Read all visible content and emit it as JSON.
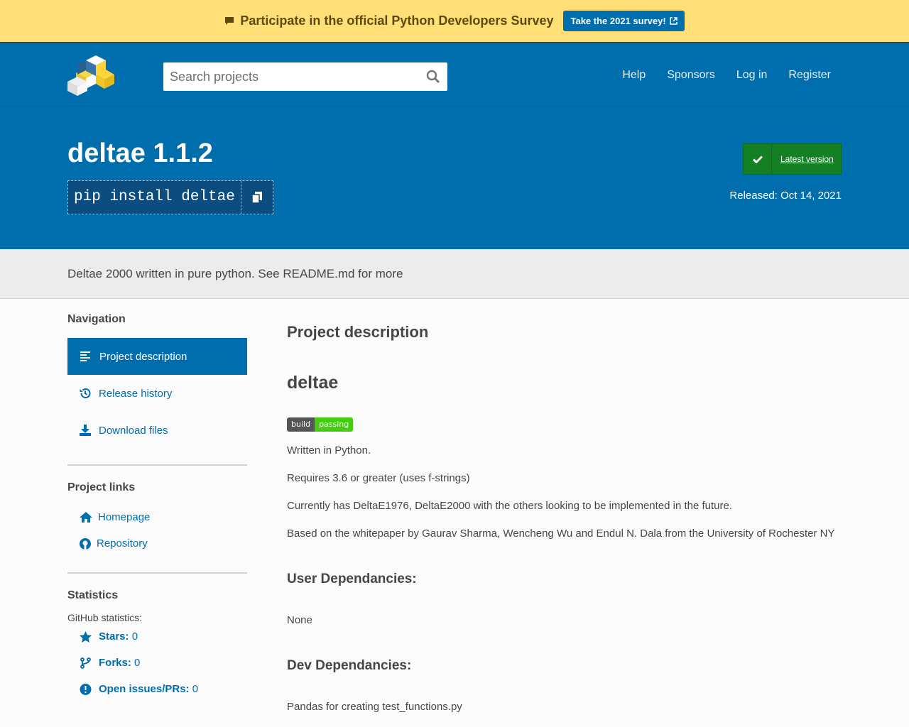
{
  "survey": {
    "message": "Participate in the official Python Developers Survey",
    "button_label": "Take the 2021 survey!"
  },
  "header": {
    "search_placeholder": "Search projects",
    "nav": [
      "Help",
      "Sponsors",
      "Log in",
      "Register"
    ]
  },
  "package": {
    "title": "deltae 1.1.2",
    "pip_command": "pip install deltae",
    "latest_label": "Latest version",
    "released": "Released: Oct 14, 2021",
    "summary": "Deltae 2000 written in pure python. See README.md for more"
  },
  "sidebar": {
    "navigation_heading": "Navigation",
    "nav_items": [
      {
        "label": "Project description",
        "icon": "align-left-icon",
        "active": true
      },
      {
        "label": "Release history",
        "icon": "history-icon",
        "active": false
      },
      {
        "label": "Download files",
        "icon": "download-icon",
        "active": false
      }
    ],
    "links_heading": "Project links",
    "links": [
      {
        "label": "Homepage",
        "icon": "home-icon"
      },
      {
        "label": "Repository",
        "icon": "github-icon"
      }
    ],
    "statistics_heading": "Statistics",
    "github_stats_label": "GitHub statistics:",
    "stats": [
      {
        "label": "Stars:",
        "value": "0",
        "icon": "star-icon"
      },
      {
        "label": "Forks:",
        "value": "0",
        "icon": "fork-icon"
      },
      {
        "label": "Open issues/PRs:",
        "value": "0",
        "icon": "exclamation-icon"
      }
    ]
  },
  "content": {
    "section_heading": "Project description",
    "readme_title": "deltae",
    "badge_left": "build",
    "badge_right": "passing",
    "paragraphs": [
      "Written in Python.",
      "Requires 3.6 or greater (uses f-strings)",
      "Currently has DeltaE1976, DeltaE2000 with the others looking to be implemented in the future.",
      "Based on the whitepaper by Gaurav Sharma, Wencheng Wu and Endul N. Dala from the University of Rochester NY"
    ],
    "user_deps_heading": "User Dependancies:",
    "user_deps": "None",
    "dev_deps_heading": "Dev Dependancies:",
    "dev_deps": "Pandas for creating test_functions.py"
  },
  "colors": {
    "brand_blue": "#006dad",
    "banner_yellow": "#ffdf76",
    "latest_green": "#148024"
  }
}
